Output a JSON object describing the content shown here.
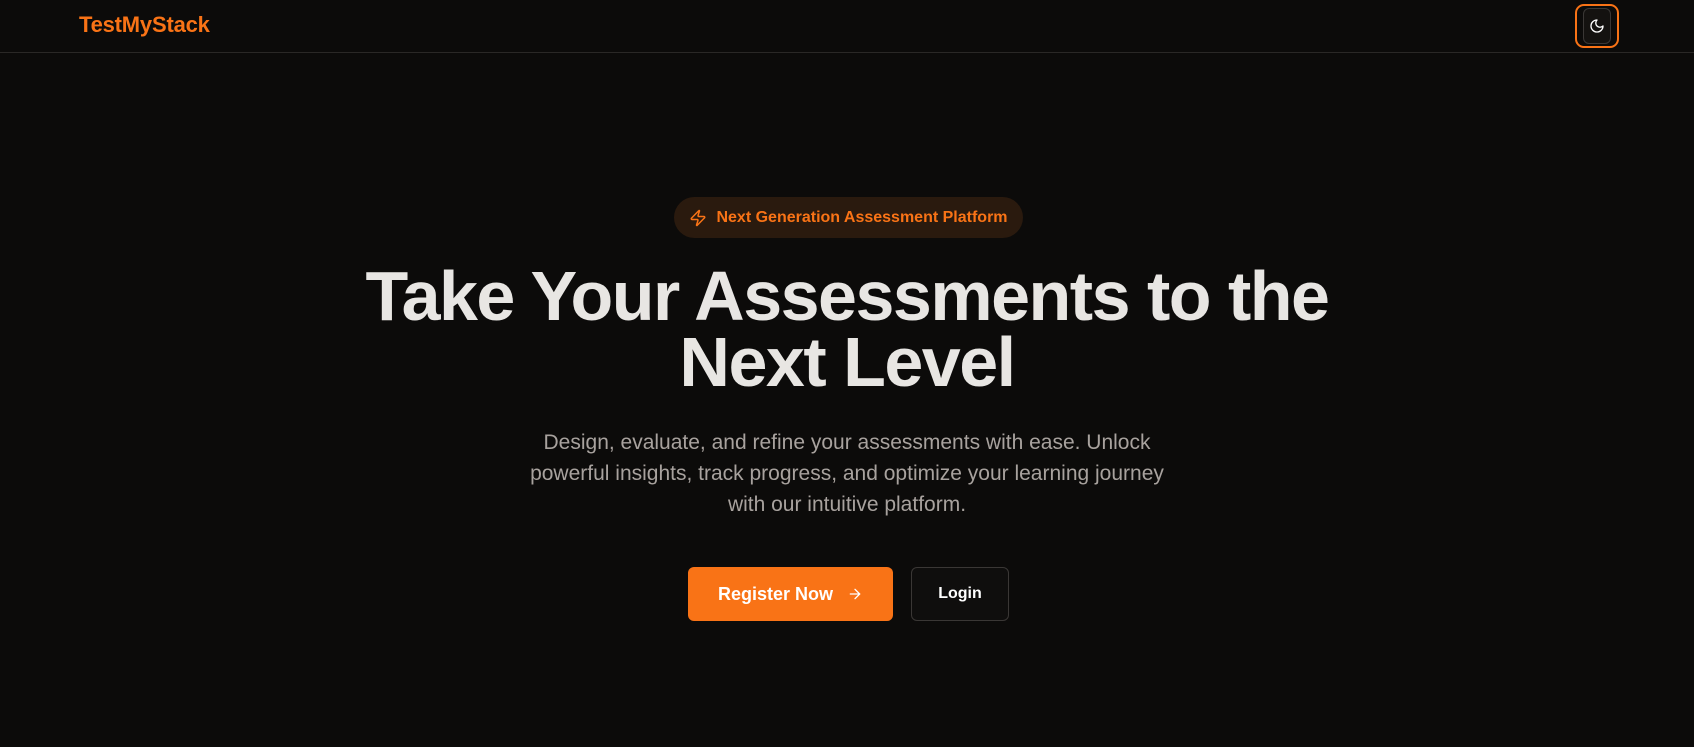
{
  "navbar": {
    "brand": "TestMyStack",
    "theme_toggle_icon": "moon-icon"
  },
  "hero": {
    "badge": {
      "icon": "lightning-icon",
      "text": "Next Generation Assessment Platform"
    },
    "headline_line1": "Take Your Assessments to the",
    "headline_line2": "Next Level",
    "subtext_line1": "Design, evaluate, and refine your assessments with ease. Unlock",
    "subtext_line2": "powerful insights, track progress, and optimize your learning journey",
    "subtext_line3": "with our intuitive platform.",
    "primary_cta": {
      "label": "Register Now",
      "icon": "arrow-right-icon"
    },
    "secondary_cta": {
      "label": "Login"
    }
  },
  "colors": {
    "background": "#0c0b0a",
    "accent": "#f97316",
    "headline": "#e8e6e3",
    "body_text": "#a8a29e",
    "badge_bg": "#2a1a0e"
  }
}
